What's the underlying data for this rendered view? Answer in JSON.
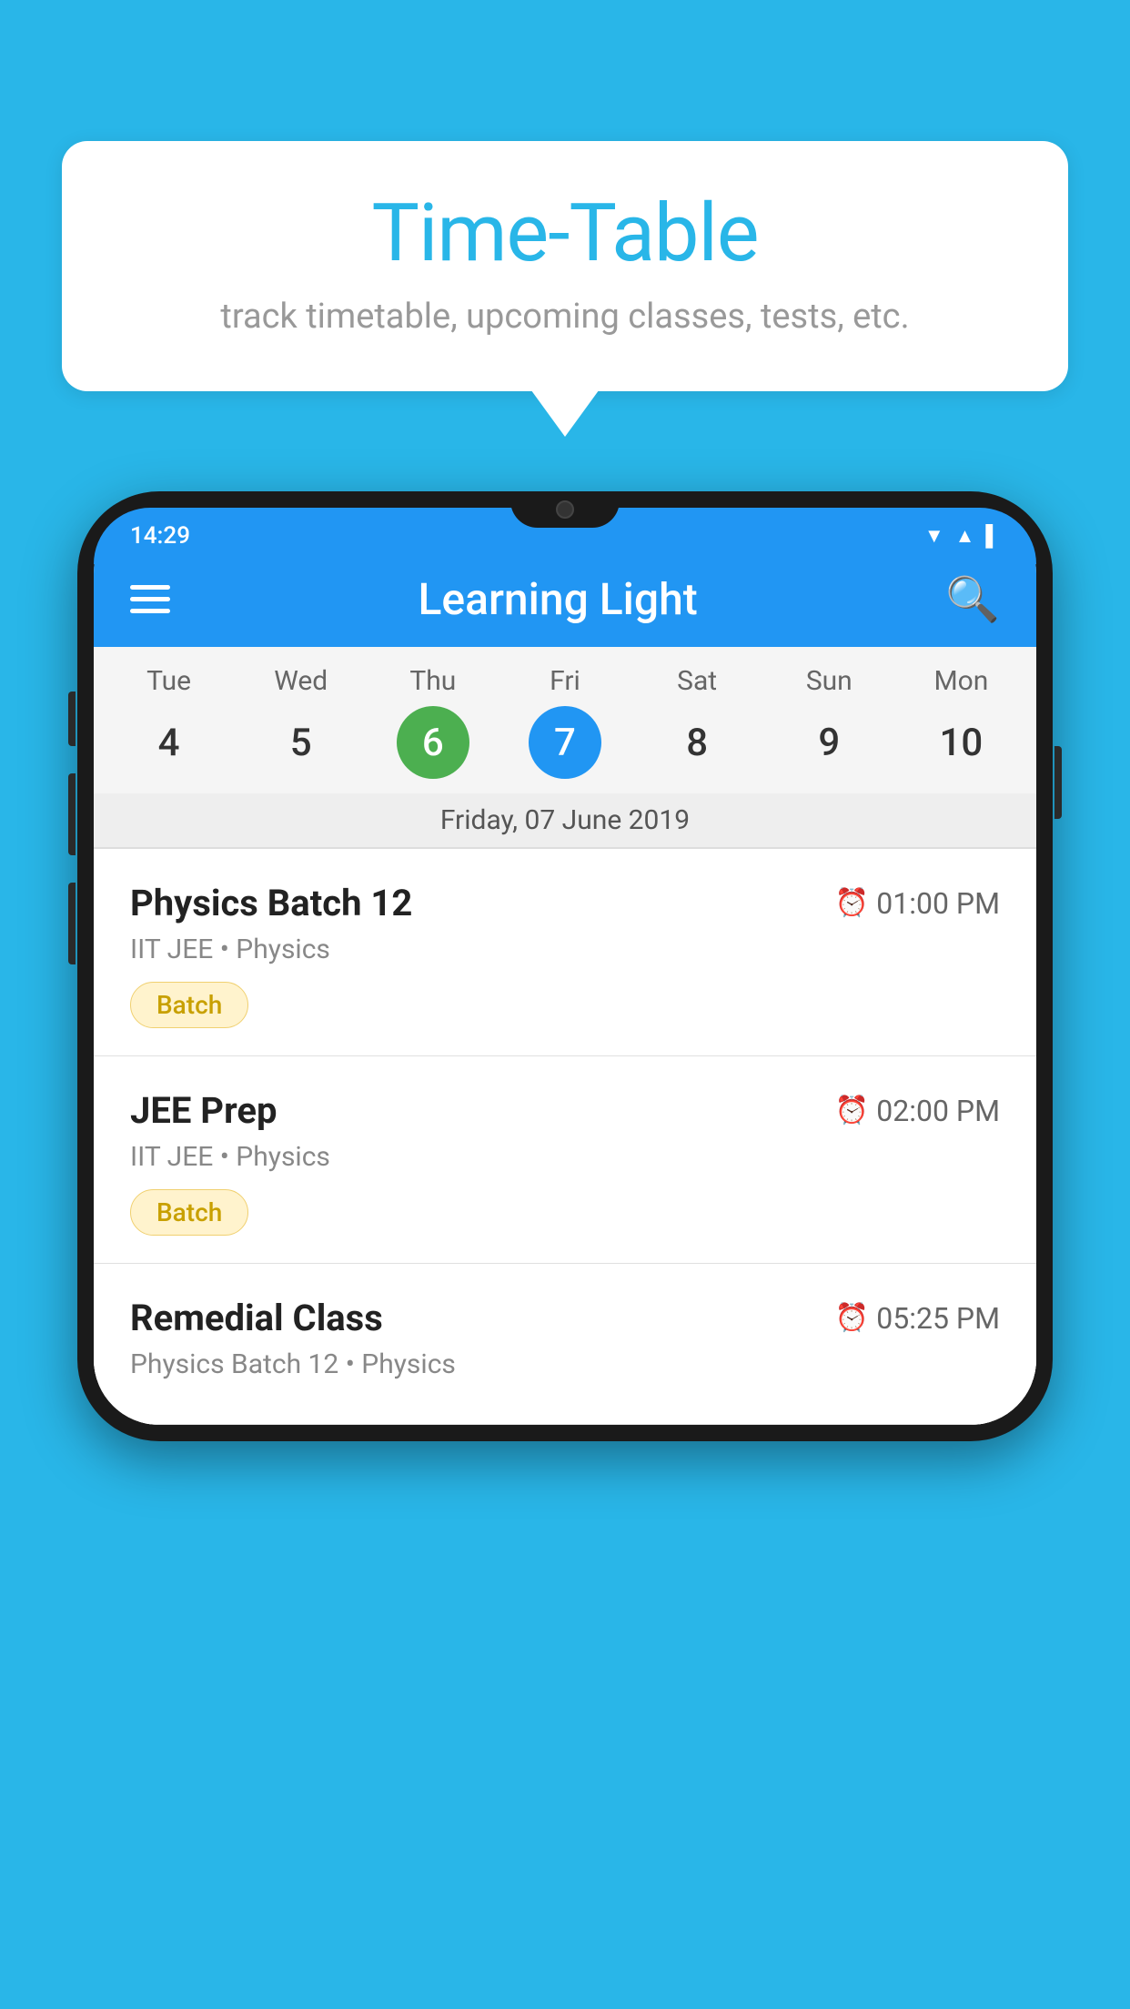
{
  "background": {
    "color": "#29b6e8"
  },
  "speech_bubble": {
    "title": "Time-Table",
    "subtitle": "track timetable, upcoming classes, tests, etc."
  },
  "phone": {
    "status_bar": {
      "time": "14:29"
    },
    "app_header": {
      "title": "Learning Light"
    },
    "calendar": {
      "days": [
        {
          "label": "Tue",
          "number": "4",
          "state": "normal"
        },
        {
          "label": "Wed",
          "number": "5",
          "state": "normal"
        },
        {
          "label": "Thu",
          "number": "6",
          "state": "today"
        },
        {
          "label": "Fri",
          "number": "7",
          "state": "selected"
        },
        {
          "label": "Sat",
          "number": "8",
          "state": "normal"
        },
        {
          "label": "Sun",
          "number": "9",
          "state": "normal"
        },
        {
          "label": "Mon",
          "number": "10",
          "state": "normal"
        }
      ],
      "selected_date_label": "Friday, 07 June 2019"
    },
    "schedule": [
      {
        "title": "Physics Batch 12",
        "time": "01:00 PM",
        "subtitle": "IIT JEE • Physics",
        "tag": "Batch"
      },
      {
        "title": "JEE Prep",
        "time": "02:00 PM",
        "subtitle": "IIT JEE • Physics",
        "tag": "Batch"
      },
      {
        "title": "Remedial Class",
        "time": "05:25 PM",
        "subtitle": "Physics Batch 12 • Physics",
        "tag": null
      }
    ]
  }
}
